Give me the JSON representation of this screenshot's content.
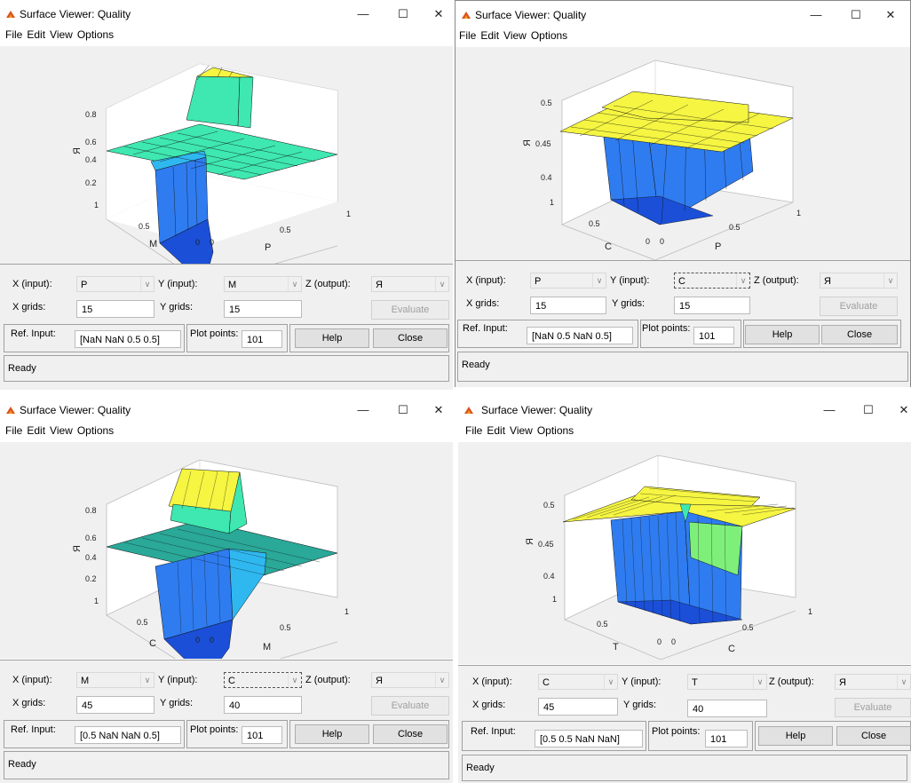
{
  "windows": [
    {
      "title": "Surface Viewer: Quality",
      "window_controls": {
        "minimize": "—",
        "maximize": "☐",
        "close": "✕"
      },
      "menu": [
        "File",
        "Edit",
        "View",
        "Options"
      ],
      "plot": {
        "zlabel": "Я",
        "xlabel": "P",
        "ylabel": "M",
        "zticks": [
          "0.8",
          "0.6",
          "0.4",
          "0.2"
        ],
        "xticks": [
          "0",
          "0.5",
          "1"
        ],
        "yticks": [
          "1",
          "0.5",
          "0"
        ]
      },
      "controls": {
        "x_input_label": "X (input):",
        "x_input_value": "P",
        "y_input_label": "Y (input):",
        "y_input_value": "M",
        "z_output_label": "Z (output):",
        "z_output_value": "Я",
        "x_grids_label": "X grids:",
        "x_grids_value": "15",
        "y_grids_label": "Y grids:",
        "y_grids_value": "15",
        "evaluate_label": "Evaluate",
        "ref_input_label": "Ref. Input:",
        "ref_input_value": "[NaN NaN 0.5 0.5]",
        "plot_points_label": "Plot points:",
        "plot_points_value": "101",
        "help_label": "Help",
        "close_label": "Close",
        "status": "Ready"
      }
    },
    {
      "title": "Surface Viewer: Quality",
      "window_controls": {
        "minimize": "—",
        "maximize": "☐",
        "close": "✕"
      },
      "menu": [
        "File",
        "Edit",
        "View",
        "Options"
      ],
      "plot": {
        "zlabel": "Я",
        "xlabel": "P",
        "ylabel": "C",
        "zticks": [
          "0.5",
          "0.45",
          "0.4"
        ],
        "xticks": [
          "0",
          "0.5",
          "1"
        ],
        "yticks": [
          "1",
          "0.5",
          "0"
        ]
      },
      "controls": {
        "x_input_label": "X (input):",
        "x_input_value": "P",
        "y_input_label": "Y (input):",
        "y_input_value": "C",
        "z_output_label": "Z (output):",
        "z_output_value": "Я",
        "x_grids_label": "X grids:",
        "x_grids_value": "15",
        "y_grids_label": "Y grids:",
        "y_grids_value": "15",
        "evaluate_label": "Evaluate",
        "ref_input_label": "Ref. Input:",
        "ref_input_value": "[NaN 0.5 NaN 0.5]",
        "plot_points_label": "Plot points:",
        "plot_points_value": "101",
        "help_label": "Help",
        "close_label": "Close",
        "status": "Ready"
      }
    },
    {
      "title": "Surface Viewer: Quality",
      "window_controls": {
        "minimize": "—",
        "maximize": "☐",
        "close": "✕"
      },
      "menu": [
        "File",
        "Edit",
        "View",
        "Options"
      ],
      "plot": {
        "zlabel": "Я",
        "xlabel": "M",
        "ylabel": "C",
        "zticks": [
          "0.8",
          "0.6",
          "0.4",
          "0.2"
        ],
        "xticks": [
          "0",
          "0.5",
          "1"
        ],
        "yticks": [
          "1",
          "0.5",
          "0"
        ]
      },
      "controls": {
        "x_input_label": "X (input):",
        "x_input_value": "M",
        "y_input_label": "Y (input):",
        "y_input_value": "C",
        "z_output_label": "Z (output):",
        "z_output_value": "Я",
        "x_grids_label": "X grids:",
        "x_grids_value": "45",
        "y_grids_label": "Y grids:",
        "y_grids_value": "40",
        "evaluate_label": "Evaluate",
        "ref_input_label": "Ref. Input:",
        "ref_input_value": "[0.5 NaN NaN 0.5]",
        "plot_points_label": "Plot points:",
        "plot_points_value": "101",
        "help_label": "Help",
        "close_label": "Close",
        "status": "Ready"
      }
    },
    {
      "title": "Surface Viewer: Quality",
      "window_controls": {
        "minimize": "—",
        "maximize": "☐",
        "close": "✕"
      },
      "menu": [
        "File",
        "Edit",
        "View",
        "Options"
      ],
      "plot": {
        "zlabel": "Я",
        "xlabel": "C",
        "ylabel": "T",
        "zticks": [
          "0.5",
          "0.45",
          "0.4"
        ],
        "xticks": [
          "0",
          "0.5",
          "1"
        ],
        "yticks": [
          "1",
          "0.5",
          "0"
        ]
      },
      "controls": {
        "x_input_label": "X (input):",
        "x_input_value": "C",
        "y_input_label": "Y (input):",
        "y_input_value": "T",
        "z_output_label": "Z (output):",
        "z_output_value": "Я",
        "x_grids_label": "X grids:",
        "x_grids_value": "45",
        "y_grids_label": "Y grids:",
        "y_grids_value": "40",
        "evaluate_label": "Evaluate",
        "ref_input_label": "Ref. Input:",
        "ref_input_value": "[0.5 0.5 NaN NaN]",
        "plot_points_label": "Plot points:",
        "plot_points_value": "101",
        "help_label": "Help",
        "close_label": "Close",
        "status": "Ready"
      }
    }
  ],
  "colors": {
    "yellow": "#f5f542",
    "cyan": "#3ee8b0",
    "teal": "#37c8a0",
    "blue": "#2f7cf0",
    "darkblue": "#1b4fd8"
  }
}
